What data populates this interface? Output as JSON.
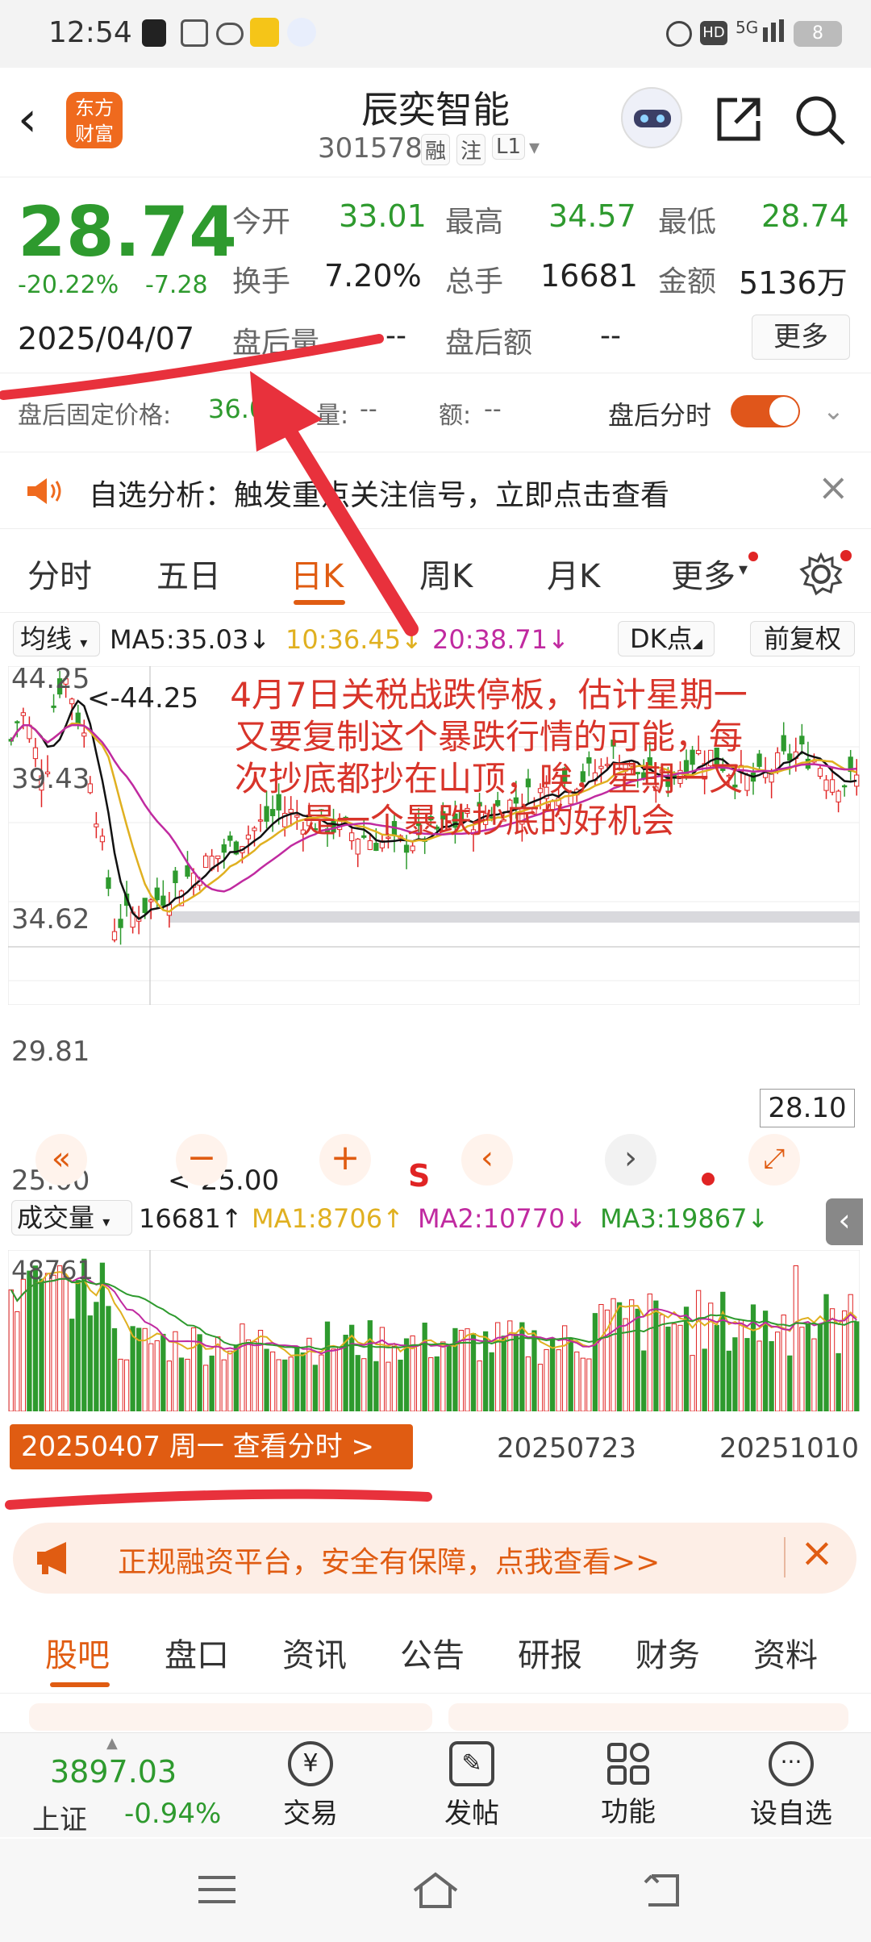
{
  "status": {
    "time": "12:54",
    "battery": "8",
    "network": "5G"
  },
  "header": {
    "logo_line1": "东方",
    "logo_line2": "财富",
    "title": "辰奕智能",
    "code": "301578",
    "tag1": "融",
    "tag2": "注",
    "tag3": "L1"
  },
  "quote": {
    "price": "28.74",
    "change_pct": "-20.22%",
    "change": "-7.28",
    "date": "2025/04/07",
    "open_label": "今开",
    "open": "33.01",
    "high_label": "最高",
    "high": "34.57",
    "low_label": "最低",
    "low": "28.74",
    "turnover_label": "换手",
    "turnover": "7.20%",
    "volume_label": "总手",
    "volume": "16681",
    "amount_label": "金额",
    "amount": "5136万",
    "after_vol_label": "盘后量",
    "after_vol": "--",
    "after_amt_label": "盘后额",
    "after_amt": "--",
    "more_button": "更多",
    "fixed_price_label": "盘后固定价格:",
    "fixed_price": "36.0",
    "fp_vol_label": "量:",
    "fp_vol": "--",
    "fp_amt_label": "额:",
    "fp_amt": "--",
    "after_timeshare_label": "盘后分时"
  },
  "notice": {
    "text": "自选分析：触发重点关注信号，立即点击查看"
  },
  "period_tabs": [
    "分时",
    "五日",
    "日K",
    "周K",
    "月K",
    "更多"
  ],
  "chart_toolbar": {
    "ma_select": "均线",
    "ma5": "MA5:35.03↓",
    "ma10": "10:36.45↓",
    "ma20": "20:38.71↓",
    "dk": "DK点",
    "adjust": "前复权"
  },
  "chart_labels": {
    "y_high": "44.25",
    "y_mid1": "39.43",
    "y_mid2": "34.62",
    "y_mid3": "29.81",
    "y_low": "25.00",
    "max_marker": "<-44.25",
    "min_marker": "<-25.00",
    "price_tag": "28.10",
    "s_marker": "S"
  },
  "annotation": {
    "line1": "4月7日关税战跌停板，估计星期一",
    "line2": "又要复制这个暴跌行情的可能，每",
    "line3": "次抄底都抄在山顶，唉，星期一又",
    "line4": "是一个暴跌抄底的好机会"
  },
  "volume_toolbar": {
    "select": "成交量",
    "vol": "16681↑",
    "ma1": "MA1:8706↑",
    "ma2": "MA2:10770↓",
    "ma3": "MA3:19867↓"
  },
  "volume_labels": {
    "y_max": "48761",
    "date1": "20250723",
    "date2": "20251010"
  },
  "selected_date_banner": "20250407 周一 查看分时 >",
  "promo": {
    "text": "正规融资平台，安全有保障，点我查看>>"
  },
  "bottom_tabs": [
    "股吧",
    "盘口",
    "资讯",
    "公告",
    "研报",
    "财务",
    "资料"
  ],
  "bottom_nav": {
    "index_value": "3897.03",
    "index_name": "上证",
    "index_change": "-0.94%",
    "trade": "交易",
    "post": "发帖",
    "func": "功能",
    "watch": "设自选"
  },
  "colors": {
    "up": "#e02424",
    "down": "#2e9a2e",
    "accent": "#e05c12"
  },
  "chart_data": {
    "type": "candlestick",
    "y_ticks": [
      44.25,
      39.43,
      34.62,
      29.81,
      25.0
    ],
    "ylim": [
      25.0,
      44.25
    ],
    "x_ticks": [
      "20250723",
      "20251010"
    ],
    "overlays": [
      "MA5",
      "MA10",
      "MA20"
    ]
  }
}
